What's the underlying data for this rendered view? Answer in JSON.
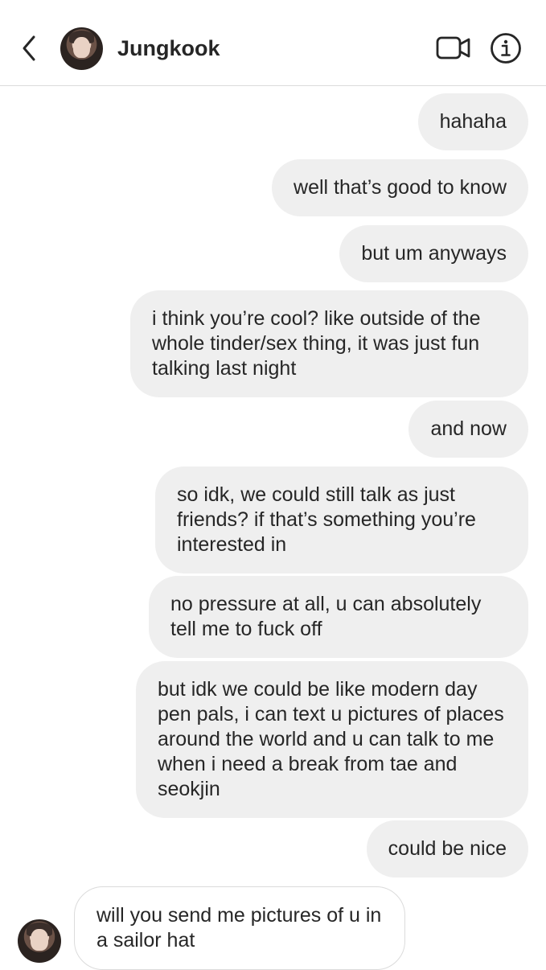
{
  "header": {
    "contact_name": "Jungkook",
    "icons": [
      "chevron-left-icon",
      "video-camera-icon",
      "info-icon"
    ]
  },
  "messages": [
    {
      "direction": "out",
      "text": "hahaha"
    },
    {
      "direction": "out",
      "text": "well that’s good to know"
    },
    {
      "direction": "out",
      "text": "but um anyways"
    },
    {
      "direction": "out",
      "text": "i think you’re cool? like outside of the whole tinder/sex thing, it was just fun talking last night"
    },
    {
      "direction": "out",
      "text": "and now"
    },
    {
      "direction": "out",
      "text": "so idk, we could still talk as just friends? if that’s something you’re interested in"
    },
    {
      "direction": "out",
      "text": "no pressure at all, u can absolutely tell me to fuck off"
    },
    {
      "direction": "out",
      "text": "but idk we could be like modern day pen pals, i can text u pictures of places around the world and u can talk to me when i need a break from tae and seokjin"
    },
    {
      "direction": "out",
      "text": "could be nice"
    },
    {
      "direction": "in",
      "text": "will you send me pictures of u in a sailor hat"
    }
  ]
}
